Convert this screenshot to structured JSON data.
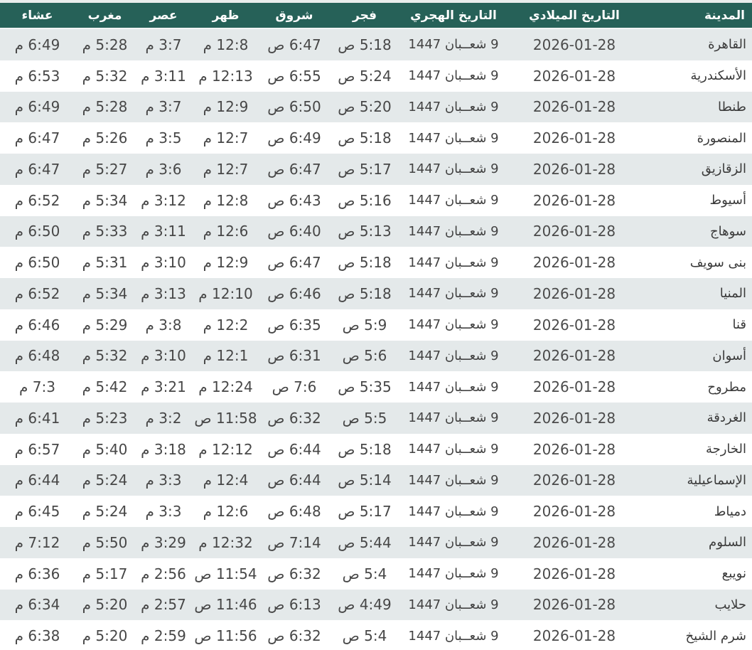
{
  "colors": {
    "header_bg": "#266158",
    "header_text": "#ffffff",
    "row_odd_bg": "#e4e9ea",
    "row_even_bg": "#ffffff",
    "body_text": "#474747"
  },
  "table": {
    "columns": [
      {
        "key": "city",
        "label": "المدينة"
      },
      {
        "key": "gregorian",
        "label": "التاريخ الميلادي"
      },
      {
        "key": "hijri",
        "label": "التاريخ الهجري"
      },
      {
        "key": "fajr",
        "label": "فجر"
      },
      {
        "key": "shuruq",
        "label": "شروق"
      },
      {
        "key": "dhuhr",
        "label": "ظهر"
      },
      {
        "key": "asr",
        "label": "عصر"
      },
      {
        "key": "maghrib",
        "label": "مغرب"
      },
      {
        "key": "isha",
        "label": "عشاء"
      }
    ],
    "rows": [
      {
        "city": "القاهرة",
        "gregorian": "2026-01-28",
        "hijri": "9 شعــبان 1447",
        "fajr": "5:18 ص",
        "shuruq": "6:47 ص",
        "dhuhr": "12:8 م",
        "asr": "3:7 م",
        "maghrib": "5:28 م",
        "isha": "6:49 م"
      },
      {
        "city": "الأسكندرية",
        "gregorian": "2026-01-28",
        "hijri": "9 شعــبان 1447",
        "fajr": "5:24 ص",
        "shuruq": "6:55 ص",
        "dhuhr": "12:13 م",
        "asr": "3:11 م",
        "maghrib": "5:32 م",
        "isha": "6:53 م"
      },
      {
        "city": "طنطا",
        "gregorian": "2026-01-28",
        "hijri": "9 شعــبان 1447",
        "fajr": "5:20 ص",
        "shuruq": "6:50 ص",
        "dhuhr": "12:9 م",
        "asr": "3:7 م",
        "maghrib": "5:28 م",
        "isha": "6:49 م"
      },
      {
        "city": "المنصورة",
        "gregorian": "2026-01-28",
        "hijri": "9 شعــبان 1447",
        "fajr": "5:18 ص",
        "shuruq": "6:49 ص",
        "dhuhr": "12:7 م",
        "asr": "3:5 م",
        "maghrib": "5:26 م",
        "isha": "6:47 م"
      },
      {
        "city": "الزقازيق",
        "gregorian": "2026-01-28",
        "hijri": "9 شعــبان 1447",
        "fajr": "5:17 ص",
        "shuruq": "6:47 ص",
        "dhuhr": "12:7 م",
        "asr": "3:6 م",
        "maghrib": "5:27 م",
        "isha": "6:47 م"
      },
      {
        "city": "أسيوط",
        "gregorian": "2026-01-28",
        "hijri": "9 شعــبان 1447",
        "fajr": "5:16 ص",
        "shuruq": "6:43 ص",
        "dhuhr": "12:8 م",
        "asr": "3:12 م",
        "maghrib": "5:34 م",
        "isha": "6:52 م"
      },
      {
        "city": "سوهاج",
        "gregorian": "2026-01-28",
        "hijri": "9 شعــبان 1447",
        "fajr": "5:13 ص",
        "shuruq": "6:40 ص",
        "dhuhr": "12:6 م",
        "asr": "3:11 م",
        "maghrib": "5:33 م",
        "isha": "6:50 م"
      },
      {
        "city": "بنى سويف",
        "gregorian": "2026-01-28",
        "hijri": "9 شعــبان 1447",
        "fajr": "5:18 ص",
        "shuruq": "6:47 ص",
        "dhuhr": "12:9 م",
        "asr": "3:10 م",
        "maghrib": "5:31 م",
        "isha": "6:50 م"
      },
      {
        "city": "المنيا",
        "gregorian": "2026-01-28",
        "hijri": "9 شعــبان 1447",
        "fajr": "5:18 ص",
        "shuruq": "6:46 ص",
        "dhuhr": "12:10 م",
        "asr": "3:13 م",
        "maghrib": "5:34 م",
        "isha": "6:52 م"
      },
      {
        "city": "قنا",
        "gregorian": "2026-01-28",
        "hijri": "9 شعــبان 1447",
        "fajr": "5:9 ص",
        "shuruq": "6:35 ص",
        "dhuhr": "12:2 م",
        "asr": "3:8 م",
        "maghrib": "5:29 م",
        "isha": "6:46 م"
      },
      {
        "city": "أسوان",
        "gregorian": "2026-01-28",
        "hijri": "9 شعــبان 1447",
        "fajr": "5:6 ص",
        "shuruq": "6:31 ص",
        "dhuhr": "12:1 م",
        "asr": "3:10 م",
        "maghrib": "5:32 م",
        "isha": "6:48 م"
      },
      {
        "city": "مطروح",
        "gregorian": "2026-01-28",
        "hijri": "9 شعــبان 1447",
        "fajr": "5:35 ص",
        "shuruq": "7:6 ص",
        "dhuhr": "12:24 م",
        "asr": "3:21 م",
        "maghrib": "5:42 م",
        "isha": "7:3 م"
      },
      {
        "city": "الغردقة",
        "gregorian": "2026-01-28",
        "hijri": "9 شعــبان 1447",
        "fajr": "5:5 ص",
        "shuruq": "6:32 ص",
        "dhuhr": "11:58 ص",
        "asr": "3:2 م",
        "maghrib": "5:23 م",
        "isha": "6:41 م"
      },
      {
        "city": "الخارجة",
        "gregorian": "2026-01-28",
        "hijri": "9 شعــبان 1447",
        "fajr": "5:18 ص",
        "shuruq": "6:44 ص",
        "dhuhr": "12:12 م",
        "asr": "3:18 م",
        "maghrib": "5:40 م",
        "isha": "6:57 م"
      },
      {
        "city": "الإسماعيلية",
        "gregorian": "2026-01-28",
        "hijri": "9 شعــبان 1447",
        "fajr": "5:14 ص",
        "shuruq": "6:44 ص",
        "dhuhr": "12:4 م",
        "asr": "3:3 م",
        "maghrib": "5:24 م",
        "isha": "6:44 م"
      },
      {
        "city": "دمياط",
        "gregorian": "2026-01-28",
        "hijri": "9 شعــبان 1447",
        "fajr": "5:17 ص",
        "shuruq": "6:48 ص",
        "dhuhr": "12:6 م",
        "asr": "3:3 م",
        "maghrib": "5:24 م",
        "isha": "6:45 م"
      },
      {
        "city": "السلوم",
        "gregorian": "2026-01-28",
        "hijri": "9 شعــبان 1447",
        "fajr": "5:44 ص",
        "shuruq": "7:14 ص",
        "dhuhr": "12:32 م",
        "asr": "3:29 م",
        "maghrib": "5:50 م",
        "isha": "7:12 م"
      },
      {
        "city": "نويبع",
        "gregorian": "2026-01-28",
        "hijri": "9 شعــبان 1447",
        "fajr": "5:4 ص",
        "shuruq": "6:32 ص",
        "dhuhr": "11:54 ص",
        "asr": "2:56 م",
        "maghrib": "5:17 م",
        "isha": "6:36 م"
      },
      {
        "city": "حلايب",
        "gregorian": "2026-01-28",
        "hijri": "9 شعــبان 1447",
        "fajr": "4:49 ص",
        "shuruq": "6:13 ص",
        "dhuhr": "11:46 ص",
        "asr": "2:57 م",
        "maghrib": "5:20 م",
        "isha": "6:34 م"
      },
      {
        "city": "شرم الشيخ",
        "gregorian": "2026-01-28",
        "hijri": "9 شعــبان 1447",
        "fajr": "5:4 ص",
        "shuruq": "6:32 ص",
        "dhuhr": "11:56 ص",
        "asr": "2:59 م",
        "maghrib": "5:20 م",
        "isha": "6:38 م"
      }
    ]
  }
}
